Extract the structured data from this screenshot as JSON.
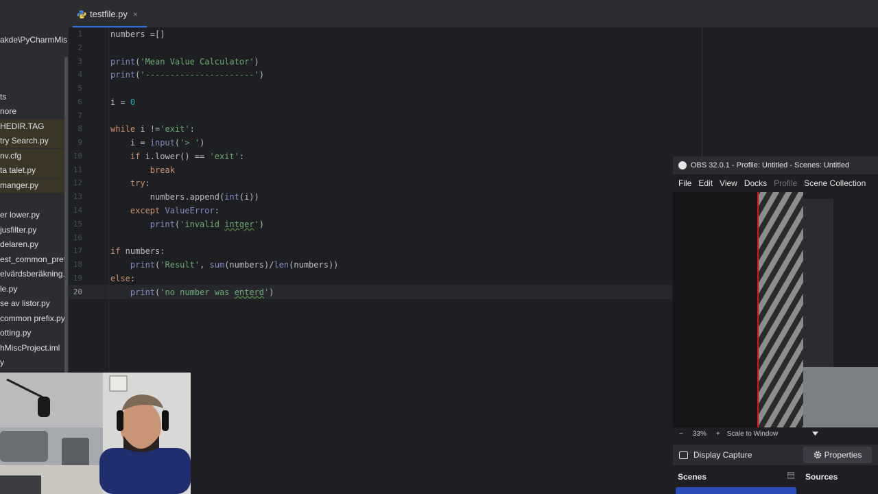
{
  "editor_tab": {
    "filename": "testfile.py",
    "close": "×"
  },
  "sidebar": {
    "path": "akde\\PyCharmMis",
    "items": [
      {
        "label": "ts"
      },
      {
        "label": "nore"
      },
      {
        "label": "HEDIR.TAG"
      },
      {
        "label": "try Search.py"
      },
      {
        "label": "nv.cfg"
      },
      {
        "label": "ta talet.py"
      },
      {
        "label": "manger.py"
      },
      {
        "label": "er lower.py"
      },
      {
        "label": "jusfilter.py"
      },
      {
        "label": "delaren.py"
      },
      {
        "label": "est_common_prefi"
      },
      {
        "label": "elvärdsberäkning.p"
      },
      {
        "label": "le.py"
      },
      {
        "label": "se av listor.py"
      },
      {
        "label": " common prefix.py"
      },
      {
        "label": "otting.py"
      },
      {
        "label": "hMiscProject.iml"
      },
      {
        "label": "y"
      }
    ]
  },
  "editor": {
    "line_numbers": [
      "1",
      "2",
      "3",
      "4",
      "5",
      "6",
      "7",
      "8",
      "9",
      "10",
      "11",
      "12",
      "13",
      "14",
      "15",
      "16",
      "17",
      "18",
      "19",
      "20"
    ],
    "current_line": "20",
    "code": {
      "l1": "numbers =[]",
      "l3_fn": "print",
      "l3_open": "(",
      "l3_str": "'Mean Value Calculator'",
      "l3_close": ")",
      "l4_fn": "print",
      "l4_open": "(",
      "l4_str": "'----------------------'",
      "l4_close": ")",
      "l6_a": "i = ",
      "l6_num": "0",
      "l8_kw": "while",
      "l8_mid": " i !=",
      "l8_str": "'exit'",
      "l8_end": ":",
      "l9_a": "    i = ",
      "l9_fn": "input",
      "l9_open": "(",
      "l9_str": "'> '",
      "l9_close": ")",
      "l10_kw": "    if",
      "l10_mid": " i.lower() == ",
      "l10_str": "'exit'",
      "l10_end": ":",
      "l11_kw": "        break",
      "l12_kw": "    try",
      "l12_end": ":",
      "l13_a": "        numbers.append(",
      "l13_fn": "int",
      "l13_b": "(i))",
      "l14_kw": "    except",
      "l14_cls": " ValueError",
      "l14_end": ":",
      "l15_a": "        ",
      "l15_fn": "print",
      "l15_open": "(",
      "l15_str1": "'invalid ",
      "l15_typo": "intger",
      "l15_str2": "'",
      "l15_close": ")",
      "l17_kw": "if",
      "l17_b": " numbers:",
      "l18_a": "    ",
      "l18_fn": "print",
      "l18_open": "(",
      "l18_str": "'Result'",
      "l18_mid": ", ",
      "l18_fn2": "sum",
      "l18_mid2": "(numbers)/",
      "l18_fn3": "len",
      "l18_end": "(numbers))",
      "l19_kw": "else",
      "l19_end": ":",
      "l20_a": "    ",
      "l20_fn": "print",
      "l20_open": "(",
      "l20_str1": "'no number was ",
      "l20_typo": "enterd",
      "l20_str2": "'",
      "l20_close": ")"
    }
  },
  "obs": {
    "title": "OBS 32.0.1 - Profile: Untitled - Scenes: Untitled",
    "menu": [
      "File",
      "Edit",
      "View",
      "Docks",
      "Profile",
      "Scene Collection"
    ],
    "zoom_minus": "−",
    "zoom": "33%",
    "zoom_plus": "+",
    "scale_mode": "Scale to Window",
    "source_name": "Display Capture",
    "properties_label": "Properties",
    "scenes_label": "Scenes",
    "sources_label": "Sources"
  },
  "colors": {
    "keyword": "#cf8e6d",
    "string": "#6aab73",
    "number": "#2aacb8",
    "builtin": "#8888c6",
    "tab_accent": "#3574f0",
    "obs_red_marker": "#e01414"
  },
  "icons": [
    "python-file-icon",
    "close-tab-icon",
    "obs-logo-icon",
    "monitor-icon",
    "gear-icon",
    "dock-menu-icon",
    "dropdown-chevron-icon"
  ]
}
